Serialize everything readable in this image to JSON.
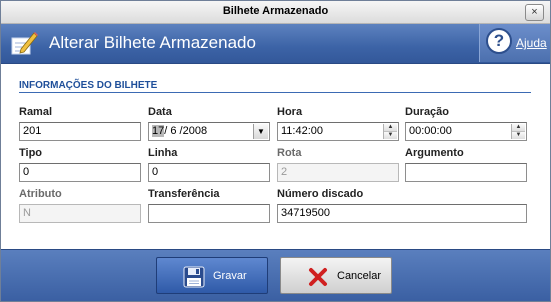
{
  "window": {
    "title": "Bilhete Armazenado",
    "close_glyph": "×"
  },
  "header": {
    "title": "Alterar Bilhete Armazenado",
    "help_label": "Ajuda",
    "help_glyph": "?",
    "icon": "edit-pencil-icon"
  },
  "section": {
    "title": "INFORMAÇÕES DO BILHETE"
  },
  "fields": {
    "ramal": {
      "label": "Ramal",
      "value": "201"
    },
    "data": {
      "label": "Data",
      "value_day": "17",
      "value_rest": "/ 6 /2008"
    },
    "hora": {
      "label": "Hora",
      "value": "11:42:00"
    },
    "duracao": {
      "label": "Duração",
      "value": "00:00:00"
    },
    "tipo": {
      "label": "Tipo",
      "value": "0"
    },
    "linha": {
      "label": "Linha",
      "value": "0"
    },
    "rota": {
      "label": "Rota",
      "value": "2"
    },
    "argumento": {
      "label": "Argumento",
      "value": ""
    },
    "atributo": {
      "label": "Atributo",
      "value": "N"
    },
    "transferencia": {
      "label": "Transferência",
      "value": ""
    },
    "numero_discado": {
      "label": "Número discado",
      "value": "34719500"
    }
  },
  "buttons": {
    "save_label": "Gravar",
    "cancel_label": "Cancelar"
  },
  "colors": {
    "header_blue": "#3c63a6",
    "section_blue": "#1f4f9a",
    "cancel_red": "#d02020"
  }
}
